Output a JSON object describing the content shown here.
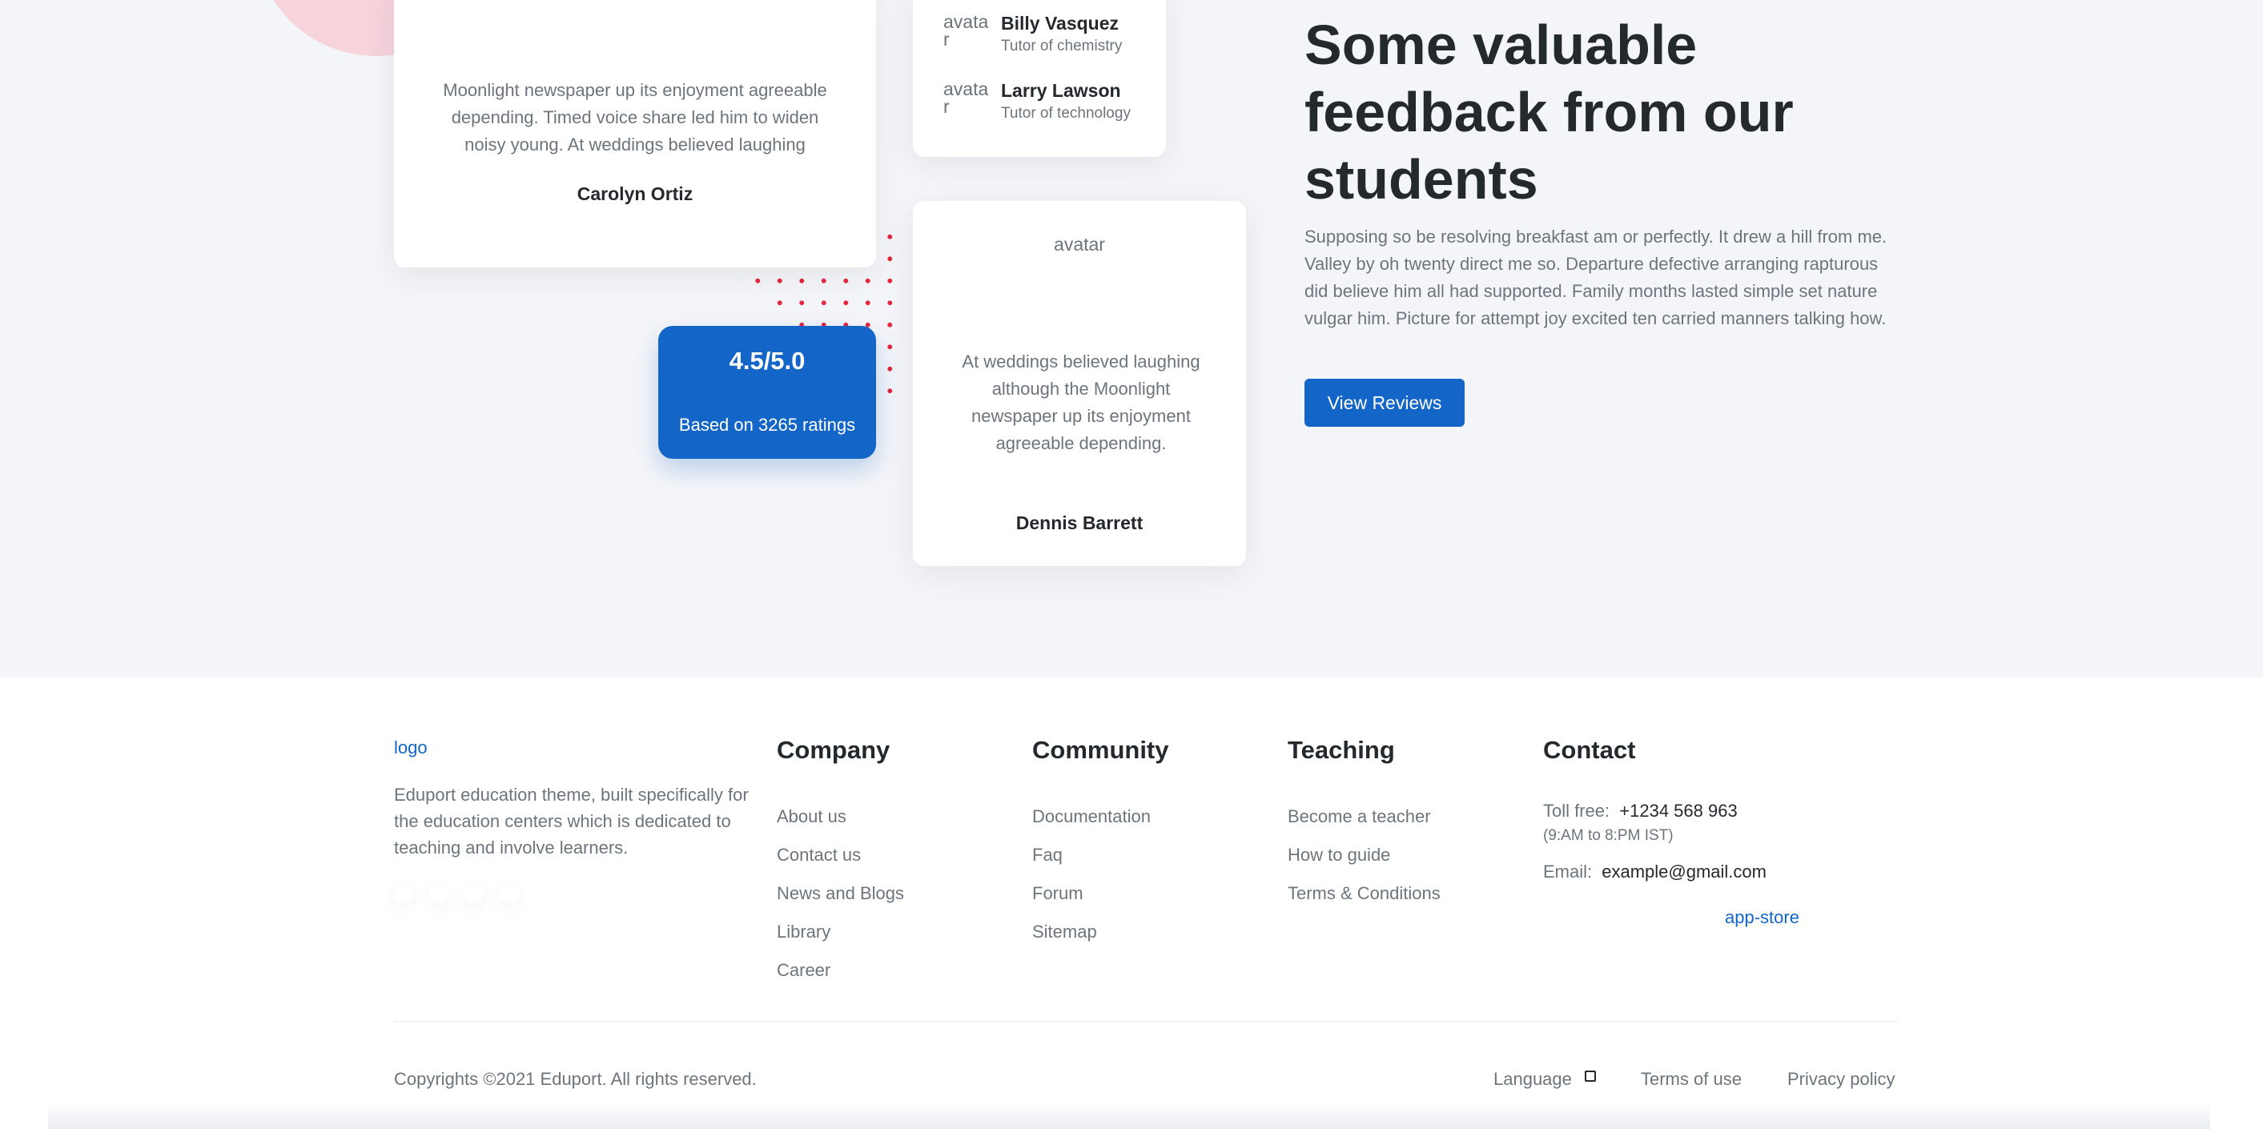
{
  "testimonials": {
    "card1": {
      "quote": "Moonlight newspaper up its enjoyment agreeable depending. Timed voice share led him to widen noisy young. At weddings believed laughing",
      "name": "Carolyn Ortiz"
    },
    "tutors": [
      {
        "avatar_alt": "avatar",
        "name": "Billy Vasquez",
        "role": "Tutor of chemistry"
      },
      {
        "avatar_alt": "avatar",
        "name": "Larry Lawson",
        "role": "Tutor of technology"
      }
    ],
    "card2": {
      "avatar_alt": "avatar",
      "quote": "At weddings believed laughing although the Moonlight newspaper up its enjoyment agreeable depending.",
      "name": "Dennis Barrett"
    },
    "rating": {
      "score": "4.5/5.0",
      "caption": "Based on 3265 ratings"
    }
  },
  "feedback": {
    "heading": "Some valuable feedback from our students",
    "paragraph": "Supposing so be resolving breakfast am or perfectly. It drew a hill from me. Valley by oh twenty direct me so. Departure defective arranging rapturous did believe him all had supported. Family months lasted simple set nature vulgar him. Picture for attempt joy excited ten carried manners talking how.",
    "button_label": "View Reviews"
  },
  "footer": {
    "logo_alt": "logo",
    "description": "Eduport education theme, built specifically for the education centers which is dedicated to teaching and involve learners.",
    "columns": [
      {
        "title": "Company",
        "links": [
          "About us",
          "Contact us",
          "News and Blogs",
          "Library",
          "Career"
        ]
      },
      {
        "title": "Community",
        "links": [
          "Documentation",
          "Faq",
          "Forum",
          "Sitemap"
        ]
      },
      {
        "title": "Teaching",
        "links": [
          "Become a teacher",
          "How to guide",
          "Terms & Conditions"
        ]
      }
    ],
    "contact": {
      "title": "Contact",
      "tollfree_label": "Toll free:",
      "tollfree_number": "+1234 568 963",
      "hours": "(9:AM to 8:PM IST)",
      "email_label": "Email:",
      "email": "example@gmail.com",
      "app_store_alt": "app-store"
    },
    "bottom": {
      "copyright": "Copyrights ©2021 Eduport. All rights reserved.",
      "language": "Language",
      "terms": "Terms of use",
      "privacy": "Privacy policy"
    }
  },
  "colors": {
    "primary": "#1366c7",
    "heading": "#24292d",
    "muted": "#6c757d",
    "hero_bg": "#f4f5f8",
    "dots": "#e5263d",
    "blob": "#f7d3dc"
  }
}
